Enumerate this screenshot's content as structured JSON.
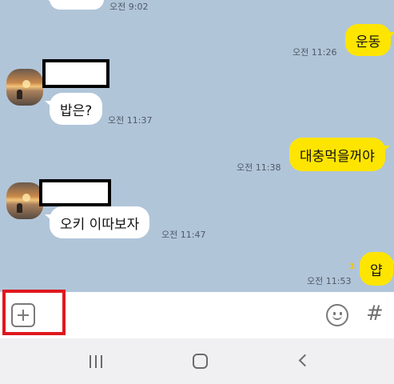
{
  "messages": [
    {
      "direction": "in",
      "text": "",
      "time": "오전 9:02"
    },
    {
      "direction": "out",
      "text": "운동",
      "time": "오전 11:26"
    },
    {
      "direction": "in",
      "text": "밥은?",
      "time": "오전 11:37"
    },
    {
      "direction": "out",
      "text": "대충먹을꺼야",
      "time": "오전 11:38"
    },
    {
      "direction": "in",
      "text": "오키 이따보자",
      "time": "오전 11:47"
    },
    {
      "direction": "out",
      "text": "얍",
      "time": "오전 11:53",
      "unread": "1"
    }
  ],
  "input_bar": {
    "attach_icon": "plus-square-icon",
    "emoji_icon": "smiley-icon",
    "hashtag_label": "#"
  },
  "nav_bar": {
    "icons": [
      "recent-apps-icon",
      "home-icon",
      "back-icon"
    ]
  },
  "colors": {
    "chat_background": "#b1c5d9",
    "outgoing_bubble": "#fee500",
    "incoming_bubble": "#ffffff",
    "highlight": "#e0181e",
    "unread_count": "#f2c500"
  }
}
